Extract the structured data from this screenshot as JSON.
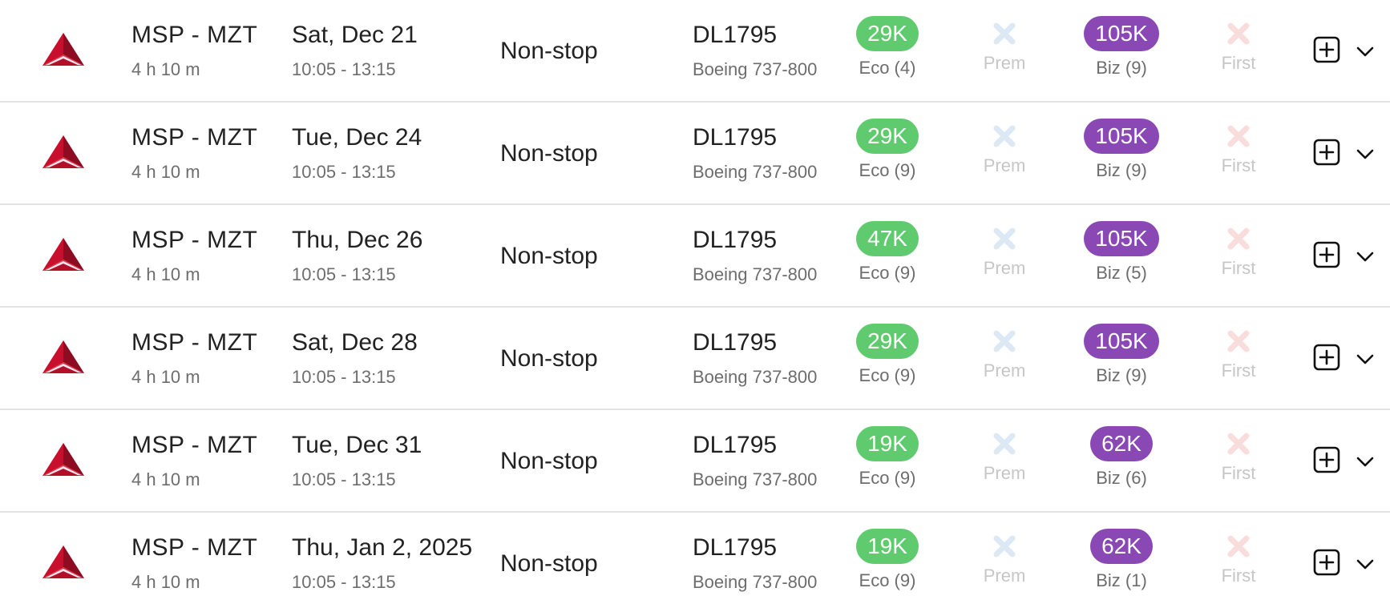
{
  "colors": {
    "eco_pill": "#5fca6e",
    "biz_pill": "#8a48b5",
    "prem_unavailable_icon": "#dce9f5",
    "first_unavailable_icon": "#f9dcdc",
    "row_divider": "#e3e3e3",
    "airline_logo": "#c8102e"
  },
  "icons": {
    "airline": "delta-widget-logo",
    "unavailable": "x-icon",
    "add": "plus-square-icon",
    "expand": "chevron-down-icon"
  },
  "flights": [
    {
      "route": "MSP - MZT",
      "duration": "4 h 10 m",
      "date": "Sat, Dec 21",
      "times": "10:05 - 13:15",
      "stops": "Non-stop",
      "flight_number": "DL1795",
      "aircraft": "Boeing 737-800",
      "eco": {
        "price": "29K",
        "label": "Eco (4)"
      },
      "prem": {
        "label": "Prem"
      },
      "biz": {
        "price": "105K",
        "label": "Biz (9)"
      },
      "first": {
        "label": "First"
      }
    },
    {
      "route": "MSP - MZT",
      "duration": "4 h 10 m",
      "date": "Tue, Dec 24",
      "times": "10:05 - 13:15",
      "stops": "Non-stop",
      "flight_number": "DL1795",
      "aircraft": "Boeing 737-800",
      "eco": {
        "price": "29K",
        "label": "Eco (9)"
      },
      "prem": {
        "label": "Prem"
      },
      "biz": {
        "price": "105K",
        "label": "Biz (9)"
      },
      "first": {
        "label": "First"
      }
    },
    {
      "route": "MSP - MZT",
      "duration": "4 h 10 m",
      "date": "Thu, Dec 26",
      "times": "10:05 - 13:15",
      "stops": "Non-stop",
      "flight_number": "DL1795",
      "aircraft": "Boeing 737-800",
      "eco": {
        "price": "47K",
        "label": "Eco (9)"
      },
      "prem": {
        "label": "Prem"
      },
      "biz": {
        "price": "105K",
        "label": "Biz (5)"
      },
      "first": {
        "label": "First"
      }
    },
    {
      "route": "MSP - MZT",
      "duration": "4 h 10 m",
      "date": "Sat, Dec 28",
      "times": "10:05 - 13:15",
      "stops": "Non-stop",
      "flight_number": "DL1795",
      "aircraft": "Boeing 737-800",
      "eco": {
        "price": "29K",
        "label": "Eco (9)"
      },
      "prem": {
        "label": "Prem"
      },
      "biz": {
        "price": "105K",
        "label": "Biz (9)"
      },
      "first": {
        "label": "First"
      }
    },
    {
      "route": "MSP - MZT",
      "duration": "4 h 10 m",
      "date": "Tue, Dec 31",
      "times": "10:05 - 13:15",
      "stops": "Non-stop",
      "flight_number": "DL1795",
      "aircraft": "Boeing 737-800",
      "eco": {
        "price": "19K",
        "label": "Eco (9)"
      },
      "prem": {
        "label": "Prem"
      },
      "biz": {
        "price": "62K",
        "label": "Biz (6)"
      },
      "first": {
        "label": "First"
      }
    },
    {
      "route": "MSP - MZT",
      "duration": "4 h 10 m",
      "date": "Thu, Jan 2, 2025",
      "times": "10:05 - 13:15",
      "stops": "Non-stop",
      "flight_number": "DL1795",
      "aircraft": "Boeing 737-800",
      "eco": {
        "price": "19K",
        "label": "Eco (9)"
      },
      "prem": {
        "label": "Prem"
      },
      "biz": {
        "price": "62K",
        "label": "Biz (1)"
      },
      "first": {
        "label": "First"
      }
    }
  ]
}
